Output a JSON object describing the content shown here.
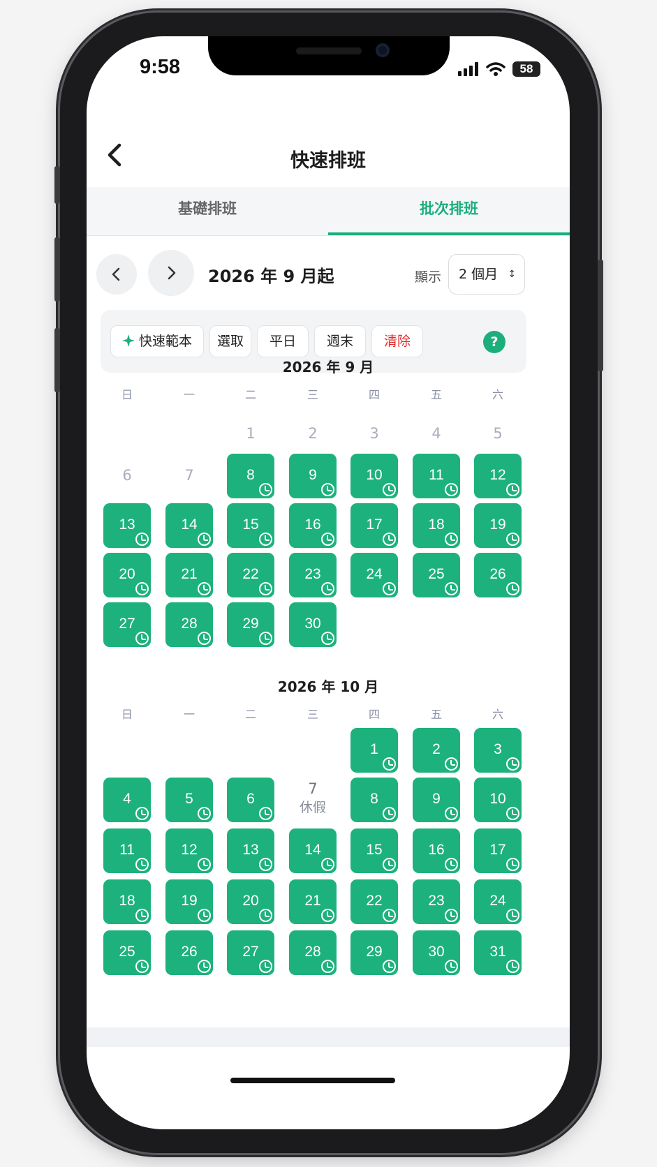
{
  "status": {
    "time": "9:58",
    "battery": "58"
  },
  "nav": {
    "title": "快速排班"
  },
  "tabs": [
    {
      "label": "基礎排班"
    },
    {
      "label": "批次排班"
    }
  ],
  "month_nav": {
    "range_label": "2026 年 9 月起",
    "show_label": "顯示",
    "months_selected": "2 個月"
  },
  "toolbar": {
    "quick_template": "快速範本",
    "select": "選取",
    "weekday": "平日",
    "weekend": "週末",
    "clear": "清除",
    "help": "?"
  },
  "weekdays": [
    "日",
    "一",
    "二",
    "三",
    "四",
    "五",
    "六"
  ],
  "months": [
    {
      "title": "2026 年 9 月",
      "days": [
        {
          "d": "1",
          "state": "empty"
        },
        {
          "d": "2",
          "state": "empty"
        },
        {
          "d": "3",
          "state": "empty"
        },
        {
          "d": "4",
          "state": "empty"
        },
        {
          "d": "5",
          "state": "empty"
        },
        {
          "d": "6",
          "state": "empty"
        },
        {
          "d": "7",
          "state": "empty"
        },
        {
          "d": "8",
          "state": "selected"
        },
        {
          "d": "9",
          "state": "selected"
        },
        {
          "d": "10",
          "state": "selected"
        },
        {
          "d": "11",
          "state": "selected"
        },
        {
          "d": "12",
          "state": "selected"
        },
        {
          "d": "13",
          "state": "selected"
        },
        {
          "d": "14",
          "state": "selected"
        },
        {
          "d": "15",
          "state": "selected"
        },
        {
          "d": "16",
          "state": "selected"
        },
        {
          "d": "17",
          "state": "selected"
        },
        {
          "d": "18",
          "state": "selected"
        },
        {
          "d": "19",
          "state": "selected"
        },
        {
          "d": "20",
          "state": "selected"
        },
        {
          "d": "21",
          "state": "selected"
        },
        {
          "d": "22",
          "state": "selected"
        },
        {
          "d": "23",
          "state": "selected"
        },
        {
          "d": "24",
          "state": "selected"
        },
        {
          "d": "25",
          "state": "selected"
        },
        {
          "d": "26",
          "state": "selected"
        },
        {
          "d": "27",
          "state": "selected"
        },
        {
          "d": "28",
          "state": "selected"
        },
        {
          "d": "29",
          "state": "selected"
        },
        {
          "d": "30",
          "state": "selected"
        }
      ]
    },
    {
      "title": "2026 年 10 月",
      "days": [
        {
          "d": "1",
          "state": "selected"
        },
        {
          "d": "2",
          "state": "selected"
        },
        {
          "d": "3",
          "state": "selected"
        },
        {
          "d": "4",
          "state": "selected"
        },
        {
          "d": "5",
          "state": "selected"
        },
        {
          "d": "6",
          "state": "selected"
        },
        {
          "d": "7",
          "state": "holiday",
          "note": "休假"
        },
        {
          "d": "8",
          "state": "selected"
        },
        {
          "d": "9",
          "state": "selected"
        },
        {
          "d": "10",
          "state": "selected"
        },
        {
          "d": "11",
          "state": "selected"
        },
        {
          "d": "12",
          "state": "selected"
        },
        {
          "d": "13",
          "state": "selected"
        },
        {
          "d": "14",
          "state": "selected"
        },
        {
          "d": "15",
          "state": "selected"
        },
        {
          "d": "16",
          "state": "selected"
        },
        {
          "d": "17",
          "state": "selected"
        },
        {
          "d": "18",
          "state": "selected"
        },
        {
          "d": "19",
          "state": "selected"
        },
        {
          "d": "20",
          "state": "selected"
        },
        {
          "d": "21",
          "state": "selected"
        },
        {
          "d": "22",
          "state": "selected"
        },
        {
          "d": "23",
          "state": "selected"
        },
        {
          "d": "24",
          "state": "selected"
        },
        {
          "d": "25",
          "state": "selected"
        },
        {
          "d": "26",
          "state": "selected"
        },
        {
          "d": "27",
          "state": "selected"
        },
        {
          "d": "28",
          "state": "selected"
        },
        {
          "d": "29",
          "state": "selected"
        },
        {
          "d": "30",
          "state": "selected"
        },
        {
          "d": "31",
          "state": "selected"
        }
      ]
    }
  ],
  "colors": {
    "accent": "#1cae7b",
    "day_fill": "#1db27d",
    "danger": "#e02b2b"
  },
  "icons": {
    "back": "chevron-left-icon",
    "prev": "chevron-left-icon",
    "next": "chevron-right-icon",
    "template": "sparkle-icon",
    "help": "question-icon",
    "day_mark": "clock-check-icon"
  }
}
